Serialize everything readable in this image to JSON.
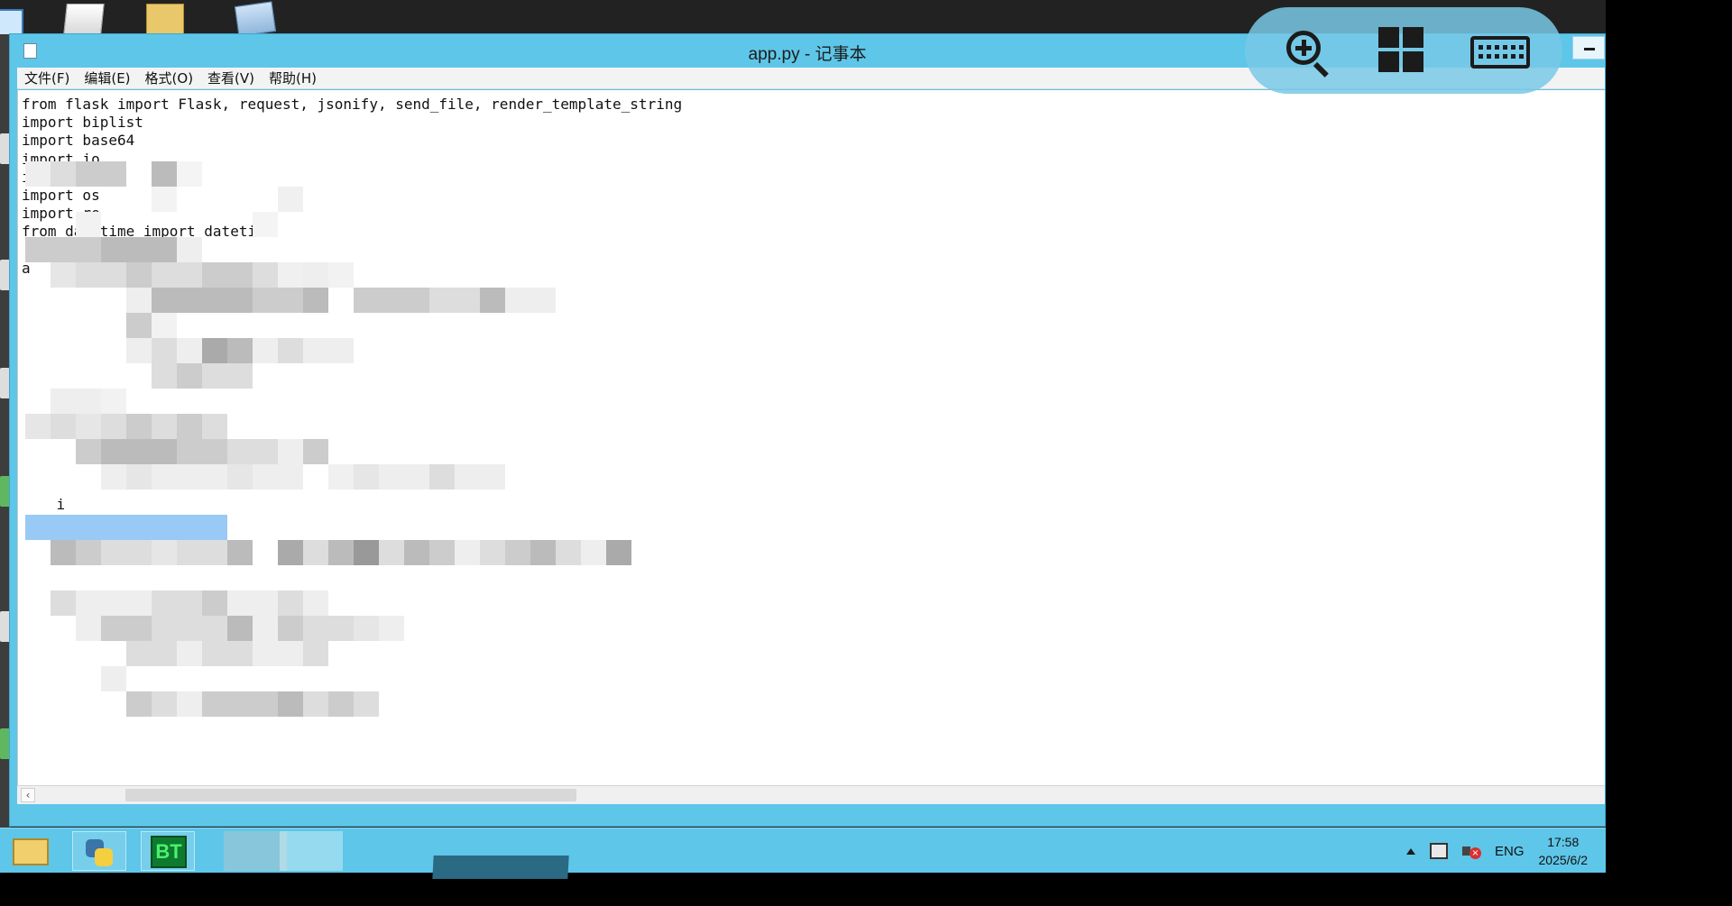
{
  "window": {
    "title": "app.py - 记事本"
  },
  "menu": {
    "items": [
      "文件(F)",
      "编辑(E)",
      "格式(O)",
      "查看(V)",
      "帮助(H)"
    ]
  },
  "editor": {
    "code_lines": [
      "from flask import Flask, request, jsonify, send_file, render_template_string",
      "import biplist",
      "import base64",
      "import io",
      "import json",
      "import os",
      "import re",
      "from datetime import datetime",
      "",
      "a",
      "",
      "",
      "",
      "",
      "",
      "",
      "        wi",
      "",
      "",
      "",
      "",
      "",
      "    i"
    ]
  },
  "overlay": {
    "buttons": [
      "zoom-in-icon",
      "windows-layout-icon",
      "keyboard-icon"
    ]
  },
  "taskbar": {
    "bt_label": "BT",
    "tray": {
      "language": "ENG",
      "time": "17:58",
      "date": "2025/6/2"
    }
  },
  "colors": {
    "chrome": "#5ec6e8",
    "selection": "#99c9f5",
    "editor_bg": "#ffffff"
  }
}
